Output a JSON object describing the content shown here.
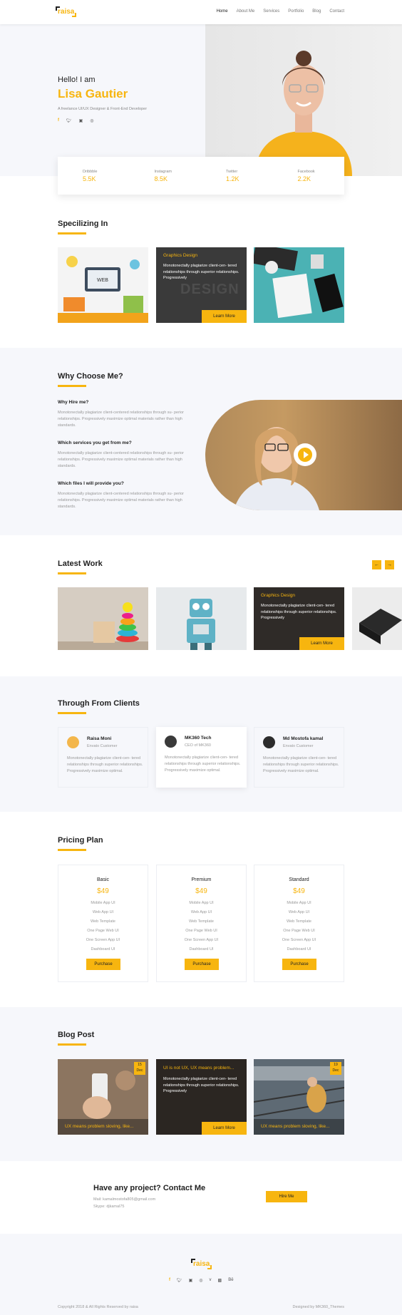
{
  "nav": {
    "logo": "raisa",
    "items": [
      "Home",
      "About Me",
      "Services",
      "Portfolio",
      "Blog",
      "Contact"
    ]
  },
  "hero": {
    "greeting": "Hello! I am",
    "name": "Lisa Gautier",
    "subtitle": "A freelance UI/UX Designer & Front-End Developer",
    "socials": [
      "facebook-icon",
      "twitter-icon",
      "instagram-icon",
      "dribbble-icon"
    ]
  },
  "stats": [
    {
      "label": "Dribbble",
      "value": "5.5K"
    },
    {
      "label": "Instagram",
      "value": "8.5K"
    },
    {
      "label": "Twitter",
      "value": "1.2K"
    },
    {
      "label": "Facebook",
      "value": "2.2K"
    }
  ],
  "specializing": {
    "title": "Specilizing In",
    "overlay_title": "Graphics Design",
    "overlay_text": "Monotonectally plagiarize client-cen- tered relationships through superior relationships. Progressively",
    "button": "Learn More"
  },
  "why": {
    "title": "Why Choose Me?",
    "items": [
      {
        "q": "Why Hire me?",
        "a": "Monotonectally plagiarize client-centered relationships through su- perior relationships. Progressively maximize optimal materials rather than high standards."
      },
      {
        "q": "Which services you get from me?",
        "a": "Monotonectally plagiarize client-centered relationships through su- perior relationships. Progressively maximize optimal materials rather than high standards."
      },
      {
        "q": "Which files I will provide you?",
        "a": "Monotonectally plagiarize client-centered relationships through su- perior relationships. Progressively maximize optimal materials rather than high standards."
      }
    ]
  },
  "work": {
    "title": "Latest Work",
    "prev": "←",
    "next": "→",
    "overlay_title": "Graphics Design",
    "overlay_text": "Monotonectally plagiarize client-cen- tered relationships through superior relationships. Progressively",
    "button": "Learn More"
  },
  "clients": {
    "title": "Through From Clients",
    "items": [
      {
        "name": "Raisa Moni",
        "role": "Envato Customer",
        "text": "Monotonectally plagiarize client-cen- tered relationships through superior relationships. Progressively maximize optimal."
      },
      {
        "name": "MK360 Tech",
        "role": "CEO of MK360",
        "text": "Monotonectally plagiarize client-cen- tered relationships through superior relationships. Progressively maximize optimal."
      },
      {
        "name": "Md Mostofa kamal",
        "role": "Envato Customer",
        "text": "Monotonectally plagiarize client-cen- tered relationships through superior relationships. Progressively maximize optimal."
      }
    ]
  },
  "pricing": {
    "title": "Pricing Plan",
    "features": [
      "Mobile App UI",
      "Web App UI",
      "Web Template",
      "One Page Web UI",
      "One Screen App UI",
      "Dashboard UI"
    ],
    "button": "Purchase",
    "plans": [
      {
        "name": "Basic",
        "price": "$49"
      },
      {
        "name": "Premium",
        "price": "$49"
      },
      {
        "name": "Standard",
        "price": "$49"
      }
    ]
  },
  "blog": {
    "title": "Blog Post",
    "posts": [
      {
        "title": "UX means problem sloving, like...",
        "day": "15",
        "month": "Dec"
      },
      {
        "title": "UI is not UX, UX means problem...",
        "text": "Monotonectally plagiarize client-cen- tered relationships through superior relationships. Progressively",
        "button": "Learn More"
      },
      {
        "title": "UX means problem sloving, like...",
        "day": "19",
        "month": "Dec"
      }
    ]
  },
  "contact": {
    "title": "Have any project? Contact Me",
    "mail": "Mail: kamalmostofa805@gmail.com",
    "skype": "Skype: djkamal75",
    "button": "Hire Me"
  },
  "footer": {
    "logo": "raisa",
    "socials": [
      "facebook-icon",
      "twitter-icon",
      "instagram-icon",
      "dribbble-icon",
      "vimeo-icon",
      "linkedin-icon",
      "behance-icon"
    ],
    "copyright": "Copyright 2018 & All Rights Reserved by raisa",
    "credit": "Designed by MK360_Themes"
  },
  "colors": {
    "accent": "#f7b50f",
    "light_bg": "#f6f7fb",
    "dark_text": "#222222"
  }
}
